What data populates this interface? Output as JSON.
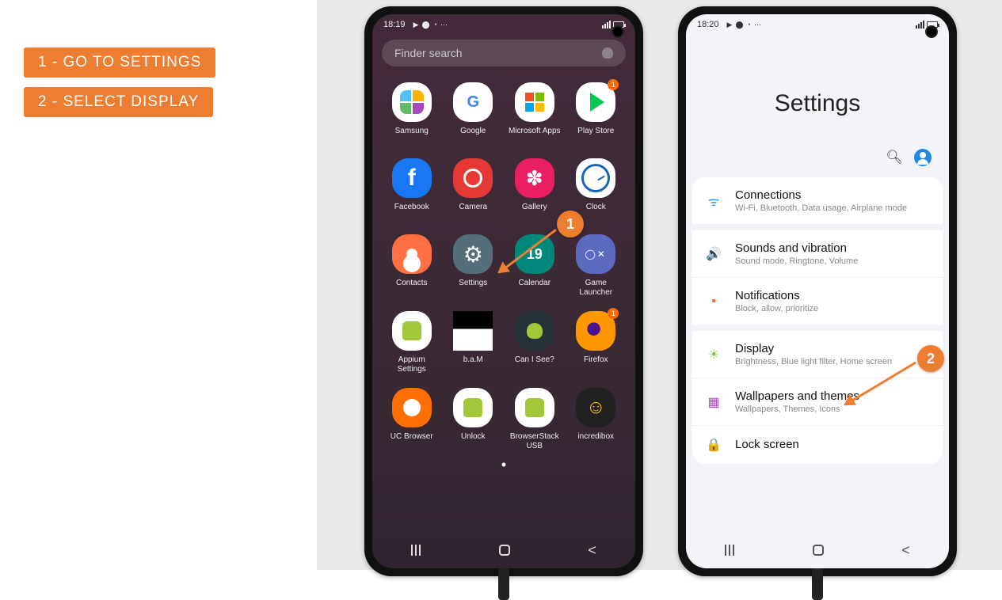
{
  "steps": {
    "one": "1 - GO TO SETTINGS",
    "two": "2 - SELECT DISPLAY"
  },
  "phone1": {
    "time": "18:19",
    "finder_placeholder": "Finder search",
    "apps": [
      {
        "label": "Samsung",
        "icon": "ic-samsung"
      },
      {
        "label": "Google",
        "icon": "ic-google"
      },
      {
        "label": "Microsoft Apps",
        "icon": "ic-ms"
      },
      {
        "label": "Play Store",
        "icon": "ic-play",
        "badge": "1"
      },
      {
        "label": "Facebook",
        "icon": "ic-fb"
      },
      {
        "label": "Camera",
        "icon": "ic-cam"
      },
      {
        "label": "Gallery",
        "icon": "ic-gal"
      },
      {
        "label": "Clock",
        "icon": "ic-clock"
      },
      {
        "label": "Contacts",
        "icon": "ic-contacts"
      },
      {
        "label": "Settings",
        "icon": "ic-settings"
      },
      {
        "label": "Calendar",
        "icon": "ic-cal"
      },
      {
        "label": "Game Launcher",
        "icon": "ic-game"
      },
      {
        "label": "Appium Settings",
        "icon": "ic-appium"
      },
      {
        "label": "b.a.M",
        "icon": "ic-bam"
      },
      {
        "label": "Can I See?",
        "icon": "ic-canisee"
      },
      {
        "label": "Firefox",
        "icon": "ic-ff",
        "badge": "1"
      },
      {
        "label": "UC Browser",
        "icon": "ic-uc"
      },
      {
        "label": "Unlock",
        "icon": "ic-unlock"
      },
      {
        "label": "BrowserStack USB",
        "icon": "ic-bsusb"
      },
      {
        "label": "incredibox",
        "icon": "ic-incred"
      }
    ]
  },
  "phone2": {
    "time": "18:20",
    "title": "Settings",
    "items": [
      {
        "icon": "ic-conn",
        "glyph": "ᯤ",
        "title": "Connections",
        "sub": "Wi-Fi, Bluetooth, Data usage, Airplane mode"
      },
      {
        "icon": "ic-sound",
        "glyph": "🔊",
        "title": "Sounds and vibration",
        "sub": "Sound mode, Ringtone, Volume",
        "gap": true
      },
      {
        "icon": "ic-notif",
        "glyph": "▪",
        "title": "Notifications",
        "sub": "Block, allow, prioritize"
      },
      {
        "icon": "ic-disp",
        "glyph": "☀",
        "title": "Display",
        "sub": "Brightness, Blue light filter, Home screen",
        "gap": true
      },
      {
        "icon": "ic-wall",
        "glyph": "▦",
        "title": "Wallpapers and themes",
        "sub": "Wallpapers, Themes, Icons"
      },
      {
        "icon": "ic-lock",
        "glyph": "🔒",
        "title": "Lock screen",
        "sub": ""
      }
    ]
  },
  "markers": {
    "m1": "1",
    "m2": "2"
  }
}
